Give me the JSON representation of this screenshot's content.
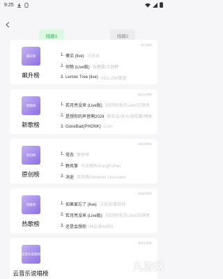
{
  "status_bar": {
    "time": "9:25"
  },
  "tabs": [
    {
      "label": "线路1"
    },
    {
      "label": "线路2"
    }
  ],
  "cards": [
    {
      "cover_text": "飙升榜",
      "name": "飙升榜",
      "update": "每日更新",
      "tracks": [
        {
          "num": "1.",
          "title": "傻瓜 (live)",
          "artist": "汪苏泷"
        },
        {
          "num": "2.",
          "title": "何物 (Live版)",
          "artist": "张碧晨/王赫野"
        },
        {
          "num": "3.",
          "title": "Lemon Tree (live)",
          "artist": "YELLOW黄宣"
        }
      ]
    },
    {
      "cover_text": "新歌榜",
      "name": "新歌榜",
      "update": "每周五更新",
      "tracks": [
        {
          "num": "1.",
          "title": "若月亮没来 (Live版)",
          "artist": "刘欣明/张杰/Jam/王铮亮"
        },
        {
          "num": "2.",
          "title": "是想你的声音啊2024",
          "artist": "郭采洁/张元/周柏豪/傅佑"
        },
        {
          "num": "3.",
          "title": "GoneBad(PHONK)",
          "artist": "DJKI"
        }
      ]
    },
    {
      "cover_text": "原创榜",
      "name": "原创榜",
      "update": "每周四更新",
      "tracks": [
        {
          "num": "1.",
          "title": "常态",
          "artist": "蔡徐坤"
        },
        {
          "num": "2.",
          "title": "野风筝",
          "artist": "马克图布/KungFuPen"
        },
        {
          "num": "3.",
          "title": "消逝",
          "artist": "亚东雨/Amoinvz Leunsone"
        }
      ]
    },
    {
      "cover_text": "热歌榜",
      "name": "热歌榜",
      "update": "每周四更新",
      "tracks": [
        {
          "num": "1.",
          "title": "如果爱忘了 (live)",
          "artist": "汪苏泷/单依纯"
        },
        {
          "num": "2.",
          "title": "若月亮没来 (Live版)",
          "artist": "刘欣明/张杰/Jam/王铮亮"
        },
        {
          "num": "3.",
          "title": "还是会想你",
          "artist": "林达浪/h3R3"
        }
      ]
    },
    {
      "cover_text": "云音乐说唱榜",
      "name": "云音乐说唱榜",
      "update": "每周五更新",
      "tracks": []
    }
  ],
  "watermark": "九游网",
  "colors": {
    "accent": "#2bb24c",
    "tab_active_bg": "#dcf8e1",
    "cover_purple": "#8d6fe3"
  }
}
